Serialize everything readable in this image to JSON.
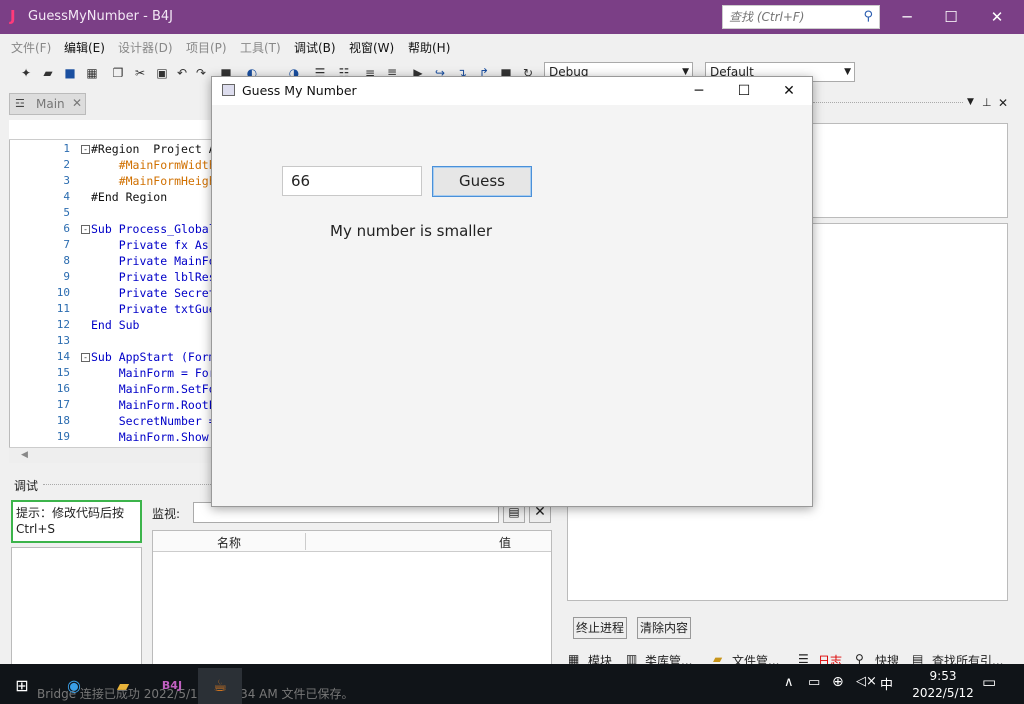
{
  "app": {
    "logo": "J",
    "title": "GuessMyNumber - B4J",
    "search_placeholder": "查找 (Ctrl+F)"
  },
  "menu": {
    "file": "文件(F)",
    "edit": "编辑(E)",
    "designer": "设计器(D)",
    "project": "项目(P)",
    "tools": "工具(T)",
    "debug": "调试(B)",
    "window": "视窗(W)",
    "help": "帮助(H)"
  },
  "toolbar": {
    "build_config": "Debug",
    "platform": "Default"
  },
  "editor": {
    "tab_label": "Main",
    "lines": [
      {
        "num": "1",
        "text": "#Region  Project A",
        "cls": "plain",
        "fold": "-"
      },
      {
        "num": "2",
        "text": "    #MainFormWidth",
        "cls": "dir",
        "fold": ""
      },
      {
        "num": "3",
        "text": "    #MainFormHeigh",
        "cls": "dir",
        "fold": ""
      },
      {
        "num": "4",
        "text": "#End Region",
        "cls": "plain",
        "fold": ""
      },
      {
        "num": "5",
        "text": "",
        "cls": "plain",
        "fold": ""
      },
      {
        "num": "6",
        "text": "Sub Process_Global",
        "cls": "kw",
        "fold": "-"
      },
      {
        "num": "7",
        "text": "    Private fx As",
        "cls": "kw",
        "fold": ""
      },
      {
        "num": "8",
        "text": "    Private MainFo",
        "cls": "kw",
        "fold": ""
      },
      {
        "num": "9",
        "text": "    Private lblRes",
        "cls": "kw",
        "fold": ""
      },
      {
        "num": "10",
        "text": "    Private Secret",
        "cls": "kw",
        "fold": ""
      },
      {
        "num": "11",
        "text": "    Private txtGue",
        "cls": "kw",
        "fold": ""
      },
      {
        "num": "12",
        "text": "End Sub",
        "cls": "kw",
        "fold": ""
      },
      {
        "num": "13",
        "text": "",
        "cls": "plain",
        "fold": ""
      },
      {
        "num": "14",
        "text": "Sub AppStart (Form",
        "cls": "kw",
        "fold": "-"
      },
      {
        "num": "15",
        "text": "    MainForm = For",
        "cls": "kw",
        "fold": ""
      },
      {
        "num": "16",
        "text": "    MainForm.SetFo",
        "cls": "kw",
        "fold": ""
      },
      {
        "num": "17",
        "text": "    MainForm.RootP",
        "cls": "kw",
        "fold": ""
      },
      {
        "num": "18",
        "text": "    SecretNumber =",
        "cls": "kw",
        "fold": ""
      },
      {
        "num": "19",
        "text": "    MainForm.Show",
        "cls": "kw",
        "fold": ""
      }
    ]
  },
  "debug_panel": {
    "title": "调试",
    "hint": "提示：修改代码后按Ctrl+S",
    "watch_label": "监视:",
    "col_name": "名称",
    "col_value": "值"
  },
  "right_panel": {
    "stop_process": "终止进程",
    "clear_content": "清除内容",
    "tabs": [
      "模块",
      "类库管...",
      "文件管...",
      "日志",
      "快搜",
      "查找所有引..."
    ]
  },
  "dialog": {
    "title": "Guess My Number",
    "input_value": "66",
    "guess_button": "Guess",
    "result_text": "My number is smaller"
  },
  "taskbar": {
    "faint_text": "Bridge 连接已成功  2022/5/12 9:50:34 AM  文件已保存。",
    "ime": "中",
    "time": "9:53",
    "date": "2022/5/12"
  }
}
